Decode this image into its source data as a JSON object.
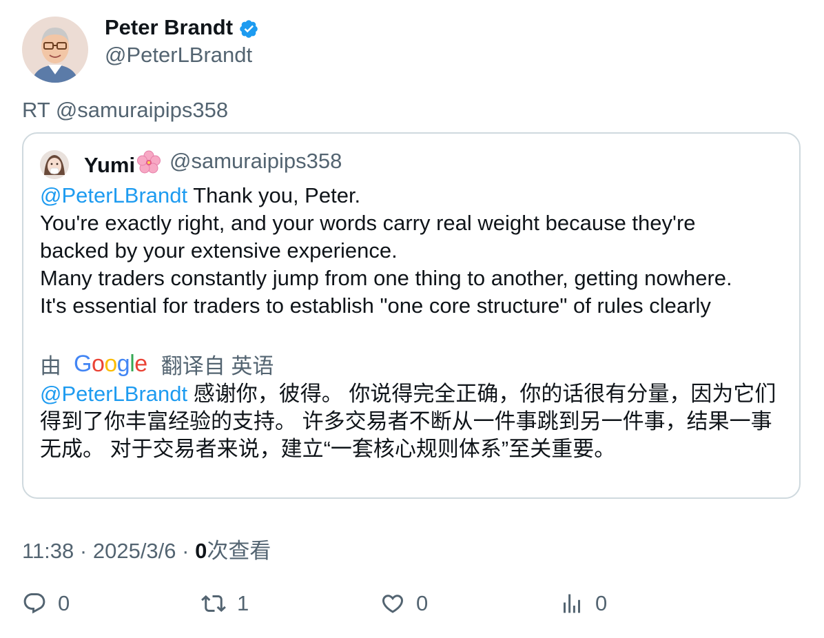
{
  "author": {
    "name": "Peter Brandt",
    "handle": "@PeterLBrandt",
    "verified_icon": "verified-badge-icon"
  },
  "retweet_label": "RT @samuraipips358",
  "quoted_tweet": {
    "name": "Yumi🌸",
    "name_text": "Yumi",
    "handle": "@samuraipips358",
    "mention": "@PeterLBrandt",
    "lines": [
      " Thank you, Peter.",
      "You're exactly right, and your words carry real weight because they're",
      "backed by your extensive experience.",
      "Many traders constantly jump from one thing to another, getting nowhere.",
      "It's essential for traders to establish \"one core structure\" of rules clearly"
    ],
    "translation": {
      "prefix": "由",
      "provider": "Google",
      "suffix": "翻译自 英语",
      "mention": "@PeterLBrandt",
      "text": " 感谢你，彼得。 你说得完全正确，你的话很有分量，因为它们得到了你丰富经验的支持。 许多交易者不断从一件事跳到另一件事，结果一事无成。 对于交易者来说，建立“一套核心规则体系”至关重要。"
    }
  },
  "meta": {
    "time": "11:38",
    "separator": "·",
    "date": "2025/3/6",
    "views_count": "0",
    "views_label": "次查看"
  },
  "actions": {
    "reply_count": "0",
    "retweet_count": "1",
    "like_count": "0",
    "views_count": "0"
  },
  "colors": {
    "accent": "#1d9bf0",
    "secondary_text": "#536471",
    "border": "#cfd9de"
  }
}
